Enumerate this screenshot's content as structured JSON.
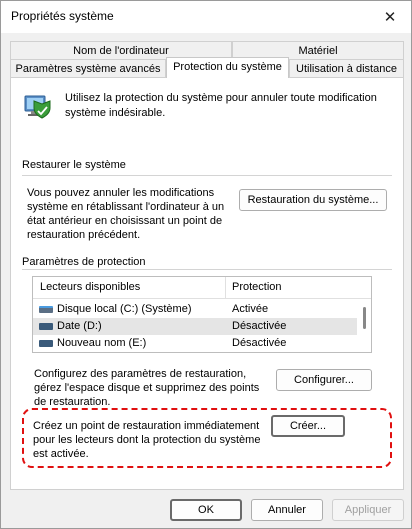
{
  "window": {
    "title": "Propriétés système"
  },
  "tabs": {
    "row_back": [
      "Nom de l'ordinateur",
      "Matériel"
    ],
    "row_front": [
      "Paramètres système avancés",
      "Protection du système",
      "Utilisation à distance"
    ],
    "active": "Protection du système"
  },
  "intro": {
    "text": "Utilisez la protection du système pour annuler toute modification système indésirable."
  },
  "restore": {
    "heading": "Restaurer le système",
    "description": "Vous pouvez annuler les modifications système en rétablissant l'ordinateur à un état antérieur en choisissant un point de restauration précédent.",
    "button": "Restauration du système..."
  },
  "protection": {
    "heading": "Paramètres de protection",
    "columns": [
      "Lecteurs disponibles",
      "Protection"
    ],
    "drives": [
      {
        "name": "Disque local (C:) (Système)",
        "status": "Activée",
        "icon": "system-drive-icon"
      },
      {
        "name": "Date (D:)",
        "status": "Désactivée",
        "icon": "drive-icon"
      },
      {
        "name": "Nouveau nom (E:)",
        "status": "Désactivée",
        "icon": "drive-icon"
      }
    ],
    "configure_text": "Configurez des paramètres de restauration, gérez l'espace disque et supprimez des points de restauration.",
    "configure_button": "Configurer...",
    "create_text": "Créez un point de restauration immédiatement pour les lecteurs dont la protection du système est activée.",
    "create_button": "Créer..."
  },
  "footer": {
    "ok": "OK",
    "cancel": "Annuler",
    "apply": "Appliquer"
  },
  "colors": {
    "highlight": "#e01010",
    "selected_row": "#e5e5e5",
    "drive_icon": "#3a5a7a"
  }
}
